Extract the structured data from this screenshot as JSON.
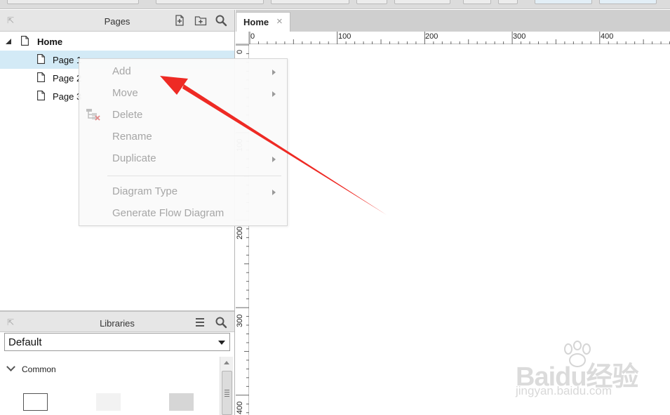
{
  "pages_panel": {
    "title": "Pages",
    "tree": [
      {
        "label": "Home",
        "level": 0,
        "bold": true,
        "expanded": true
      },
      {
        "label": "Page 1",
        "level": 1,
        "selected": true
      },
      {
        "label": "Page 2",
        "level": 1
      },
      {
        "label": "Page 3",
        "level": 1
      }
    ]
  },
  "libraries_panel": {
    "title": "Libraries",
    "selected_library": "Default",
    "group_label": "Common"
  },
  "canvas": {
    "tab_label": "Home",
    "tab_close": "×",
    "h_ruler_labels": [
      "0",
      "100",
      "200",
      "300",
      "400"
    ],
    "v_ruler_labels": [
      "0",
      "100",
      "200",
      "300",
      "400"
    ]
  },
  "context_menu": {
    "items": [
      {
        "label": "Add",
        "submenu": true
      },
      {
        "label": "Move",
        "submenu": true
      },
      {
        "label": "Delete",
        "submenu": false
      },
      {
        "label": "Rename",
        "submenu": false
      },
      {
        "label": "Duplicate",
        "submenu": true
      },
      {
        "label": "Diagram Type",
        "submenu": true
      },
      {
        "label": "Generate Flow Diagram",
        "submenu": false
      }
    ]
  },
  "colors": {
    "selection": "#d3eaf6",
    "annotation_arrow": "#ee2a24",
    "menu_text_disabled": "#a6a6a6"
  },
  "watermark": {
    "brand": "Baidu经验",
    "url": "jingyan.baidu.com"
  }
}
